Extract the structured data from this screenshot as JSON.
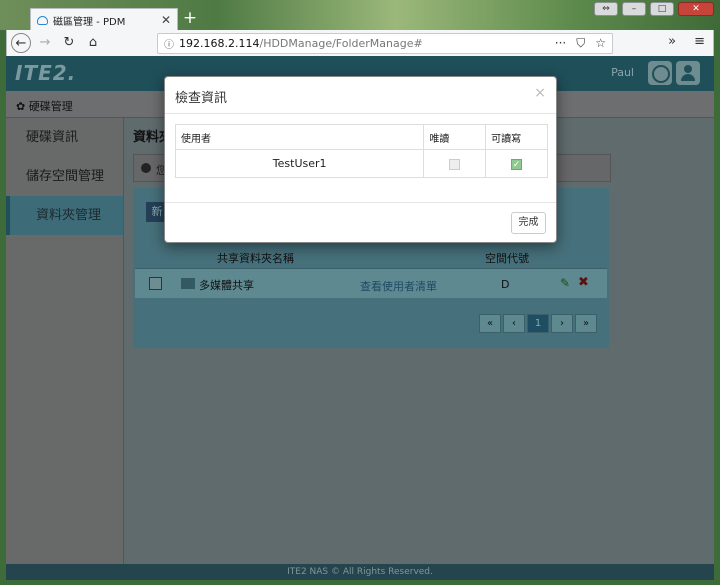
{
  "browser": {
    "tab_title": "磁區管理 - PDM",
    "tab_close": "✕",
    "new_tab": "+",
    "url_host": "192.168.2.114",
    "url_path": "/HDDManage/FolderManage#",
    "url_actions": [
      "···",
      "⛉",
      "☆"
    ],
    "toolbar_right": [
      "»",
      "≡"
    ],
    "window_buttons": [
      "⇔",
      "–",
      "□",
      "✕"
    ]
  },
  "header": {
    "logo": "ITE2.",
    "user": "Paul"
  },
  "breadcrumb": "✿ 硬碟管理",
  "sidebar": {
    "items": [
      {
        "label": "硬碟資訊",
        "active": false
      },
      {
        "label": "儲存空間管理",
        "active": false
      },
      {
        "label": "資料夾管理",
        "active": true
      }
    ]
  },
  "main": {
    "title": "資料夾",
    "info": "您",
    "new_button": "新",
    "columns": {
      "name": "共享資料夾名稱",
      "quota": "空間代號"
    },
    "rows": [
      {
        "name": "多媒體共享",
        "users_link": "查看使用者清單",
        "quota": "D"
      }
    ],
    "pager": [
      "«",
      "‹",
      "1",
      "›",
      "»"
    ],
    "current_page": "1"
  },
  "footer": "ITE2 NAS © All Rights Reserved.",
  "modal": {
    "title": "檢查資訊",
    "close": "×",
    "headers": {
      "user": "使用者",
      "read_only": "唯讀",
      "read_write": "可讀寫"
    },
    "rows": [
      {
        "user": "TestUser1",
        "read_only": false,
        "read_write": true
      }
    ],
    "done_button": "完成"
  },
  "colors": {
    "header": "#1f4f59",
    "accent": "#46707b",
    "check": "#8fc98f"
  }
}
